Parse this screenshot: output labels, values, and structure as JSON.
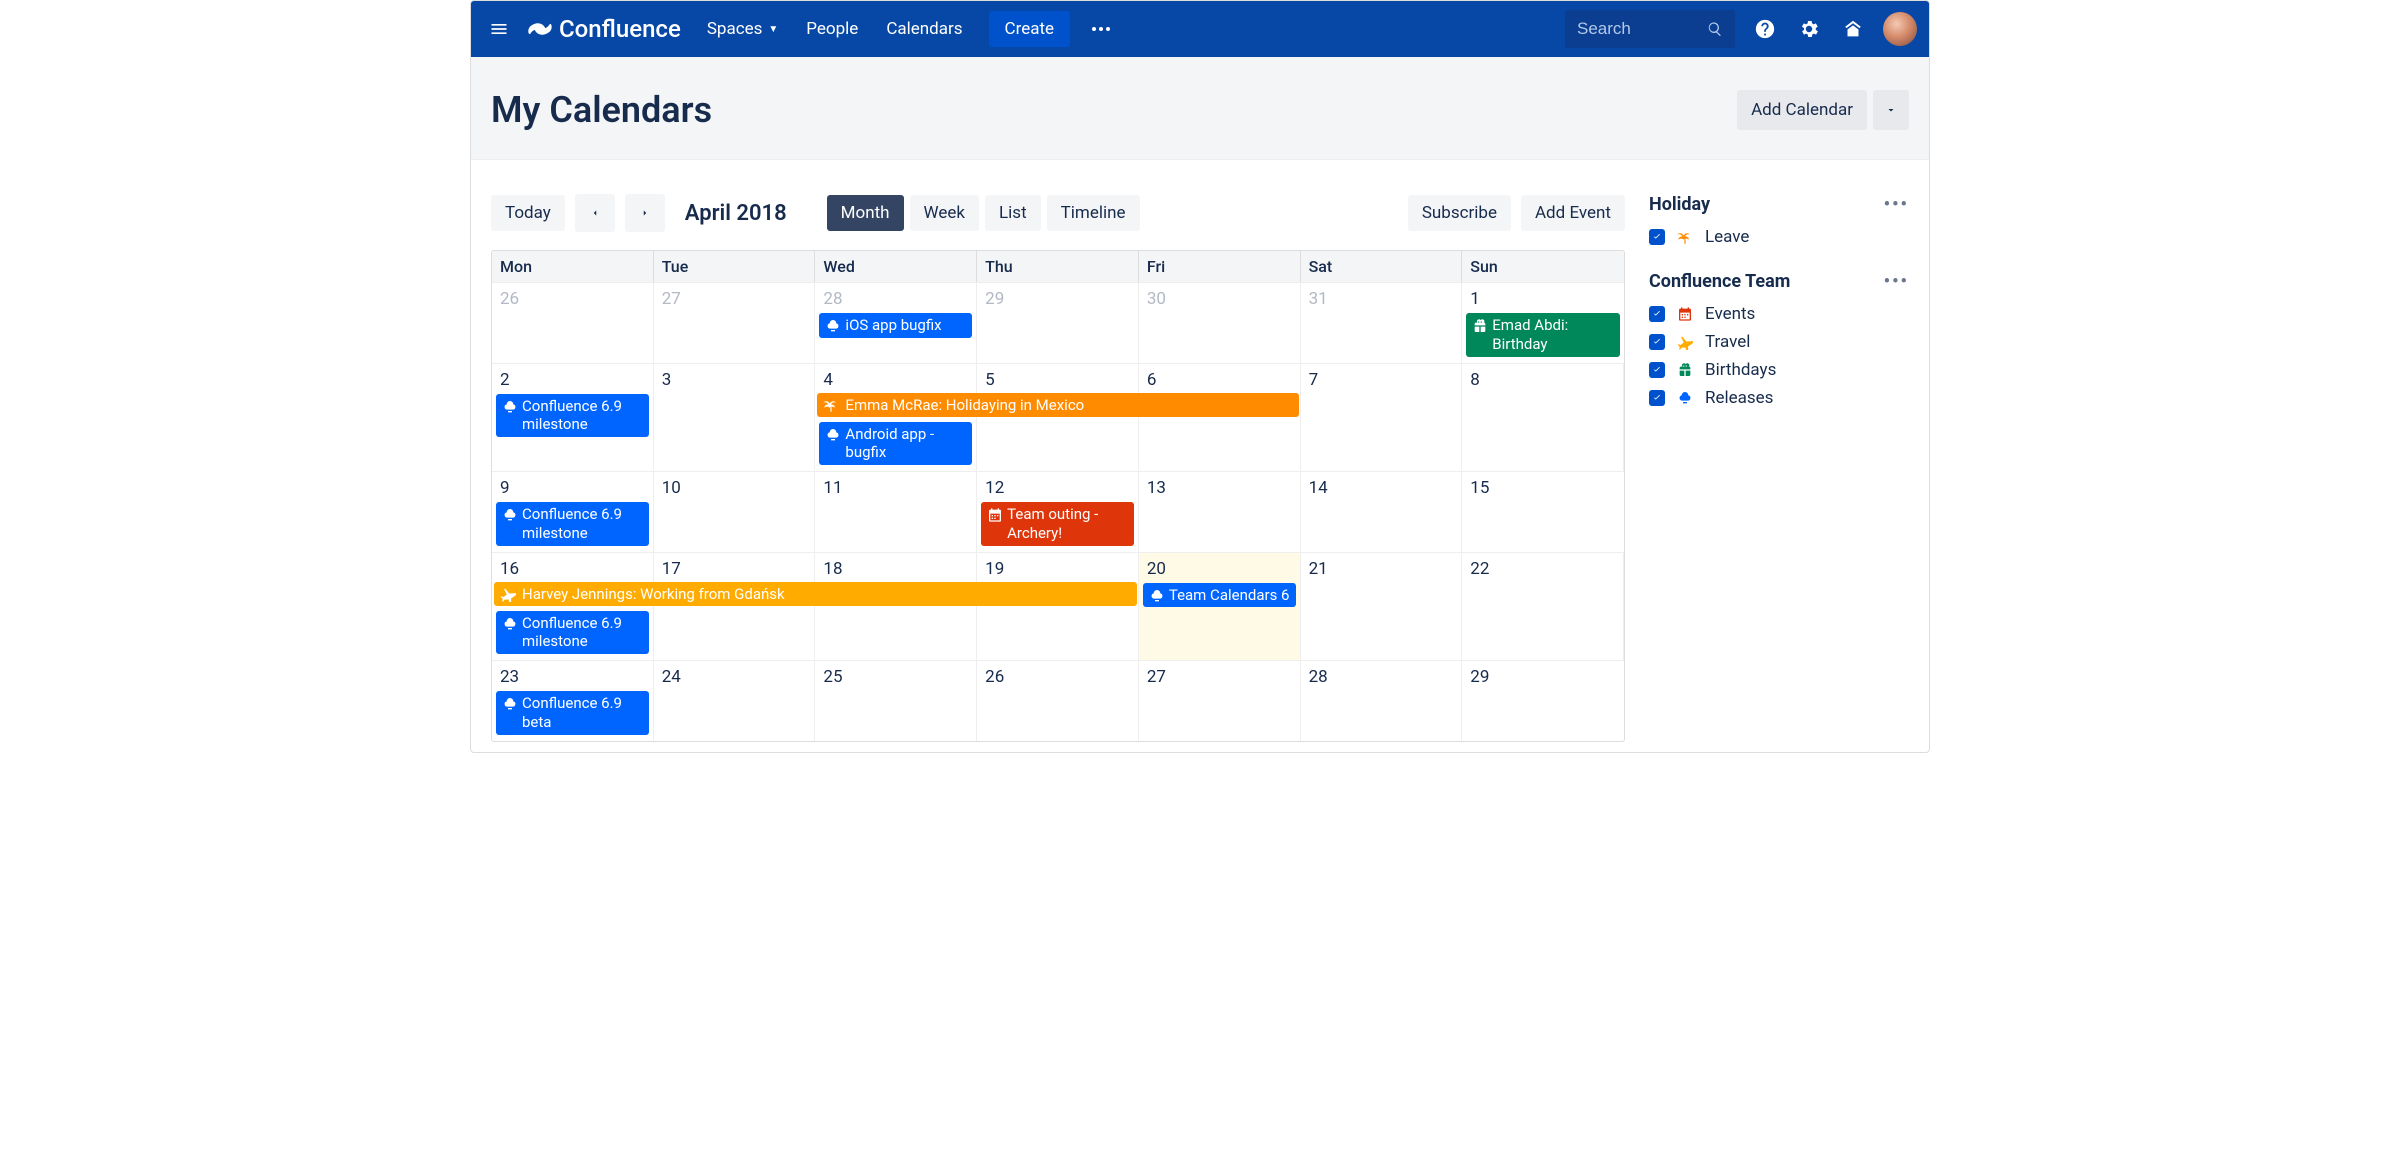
{
  "nav": {
    "brand": "Confluence",
    "items": [
      "Spaces",
      "People",
      "Calendars"
    ],
    "create": "Create",
    "search_placeholder": "Search"
  },
  "page": {
    "title": "My Calendars",
    "add_calendar": "Add Calendar"
  },
  "toolbar": {
    "today": "Today",
    "month_label": "April 2018",
    "views": [
      "Month",
      "Week",
      "List",
      "Timeline"
    ],
    "active_view": "Month",
    "subscribe": "Subscribe",
    "add_event": "Add Event"
  },
  "day_headers": [
    "Mon",
    "Tue",
    "Wed",
    "Thu",
    "Fri",
    "Sat",
    "Sun"
  ],
  "weeks": [
    {
      "days": [
        {
          "n": "26",
          "muted": true
        },
        {
          "n": "27",
          "muted": true
        },
        {
          "n": "28",
          "muted": true,
          "events": [
            {
              "t": "iOS app bugfix",
              "c": "blue",
              "icon": "release"
            }
          ]
        },
        {
          "n": "29",
          "muted": true
        },
        {
          "n": "30",
          "muted": true
        },
        {
          "n": "31",
          "muted": true
        },
        {
          "n": "1",
          "events": [
            {
              "t": "Emad Abdi: Birthday",
              "c": "green",
              "icon": "gift"
            }
          ]
        }
      ]
    },
    {
      "multi": {
        "t": "Emma McRae: Holidaying in Mexico",
        "c": "orange",
        "icon": "palm",
        "start": 2,
        "span": 3
      },
      "days": [
        {
          "n": "2",
          "events": [
            {
              "t": "Confluence 6.9 milestone",
              "c": "blue",
              "icon": "release"
            }
          ]
        },
        {
          "n": "3"
        },
        {
          "n": "4",
          "spacer": true,
          "events": [
            {
              "t": "Android app - bugfix",
              "c": "blue",
              "icon": "release"
            }
          ]
        },
        {
          "n": "5",
          "spacer": true
        },
        {
          "n": "6",
          "spacer": true
        },
        {
          "n": "7"
        },
        {
          "n": "8"
        }
      ]
    },
    {
      "days": [
        {
          "n": "9",
          "events": [
            {
              "t": "Confluence 6.9 milestone",
              "c": "blue",
              "icon": "release"
            }
          ]
        },
        {
          "n": "10"
        },
        {
          "n": "11"
        },
        {
          "n": "12",
          "events": [
            {
              "t": "Team outing - Archery!",
              "c": "red",
              "icon": "cal"
            }
          ]
        },
        {
          "n": "13"
        },
        {
          "n": "14"
        },
        {
          "n": "15"
        }
      ]
    },
    {
      "multi": {
        "t": "Harvey Jennings: Working from Gdańsk",
        "c": "yellow",
        "icon": "plane",
        "start": 0,
        "span": 4
      },
      "days": [
        {
          "n": "16",
          "spacer": true,
          "events": [
            {
              "t": "Confluence 6.9 milestone",
              "c": "blue",
              "icon": "release"
            }
          ]
        },
        {
          "n": "17",
          "spacer": true
        },
        {
          "n": "18",
          "spacer": true
        },
        {
          "n": "19",
          "spacer": true
        },
        {
          "n": "20",
          "today": true,
          "events": [
            {
              "t": "Team Calendars 6",
              "c": "blue",
              "icon": "release"
            }
          ]
        },
        {
          "n": "21"
        },
        {
          "n": "22"
        }
      ]
    },
    {
      "days": [
        {
          "n": "23",
          "events": [
            {
              "t": "Confluence 6.9 beta",
              "c": "blue",
              "icon": "release"
            }
          ]
        },
        {
          "n": "24"
        },
        {
          "n": "25"
        },
        {
          "n": "26"
        },
        {
          "n": "27"
        },
        {
          "n": "28"
        },
        {
          "n": "29"
        }
      ]
    }
  ],
  "sidebar": {
    "groups": [
      {
        "title": "Holiday",
        "items": [
          {
            "label": "Leave",
            "icon": "palm",
            "color": "#FF8B00"
          }
        ]
      },
      {
        "title": "Confluence Team",
        "items": [
          {
            "label": "Events",
            "icon": "cal",
            "color": "#DE350B"
          },
          {
            "label": "Travel",
            "icon": "plane",
            "color": "#FFAB00"
          },
          {
            "label": "Birthdays",
            "icon": "gift",
            "color": "#00875A"
          },
          {
            "label": "Releases",
            "icon": "release",
            "color": "#0065FF"
          }
        ]
      }
    ]
  }
}
